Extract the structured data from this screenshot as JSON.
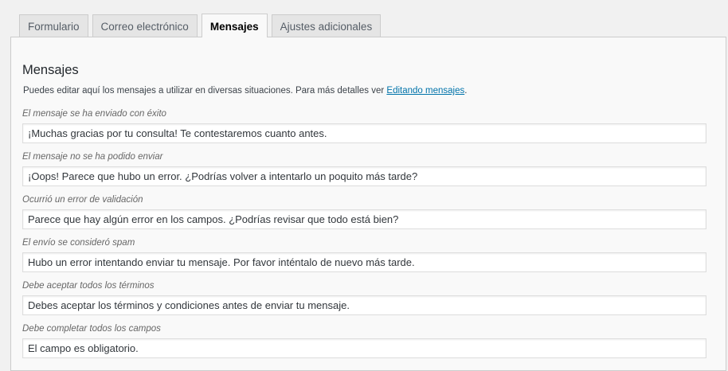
{
  "tabs": [
    {
      "label": "Formulario",
      "active": false
    },
    {
      "label": "Correo electrónico",
      "active": false
    },
    {
      "label": "Mensajes",
      "active": true
    },
    {
      "label": "Ajustes adicionales",
      "active": false
    }
  ],
  "panel": {
    "title": "Mensajes",
    "description_text": "Puedes editar aquí los mensajes a utilizar en diversas situaciones. Para más detalles ver ",
    "description_link": "Editando mensajes",
    "description_end": "."
  },
  "messages": [
    {
      "label": "El mensaje se ha enviado con éxito",
      "value": "¡Muchas gracias por tu consulta! Te contestaremos cuanto antes."
    },
    {
      "label": "El mensaje no se ha podido enviar",
      "value": "¡Oops! Parece que hubo un error. ¿Podrías volver a intentarlo un poquito más tarde?"
    },
    {
      "label": "Ocurrió un error de validación",
      "value": "Parece que hay algún error en los campos. ¿Podrías revisar que todo está bien?"
    },
    {
      "label": "El envío se consideró spam",
      "value": "Hubo un error intentando enviar tu mensaje. Por favor inténtalo de nuevo más tarde."
    },
    {
      "label": "Debe aceptar todos los términos",
      "value": "Debes aceptar los términos y condiciones antes de enviar tu mensaje."
    },
    {
      "label": "Debe completar todos los campos",
      "value": "El campo es obligatorio."
    }
  ],
  "colors": {
    "link": "#0073aa",
    "panel_background": "#f9f9f9",
    "page_background": "#f1f1f1"
  }
}
